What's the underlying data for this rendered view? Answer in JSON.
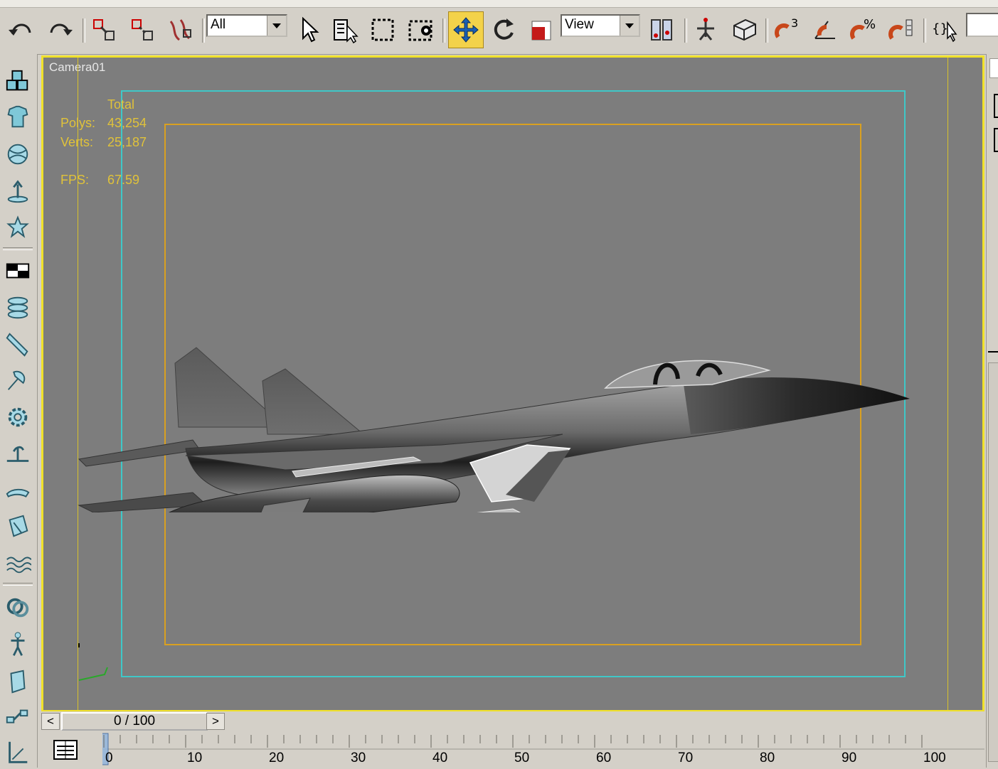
{
  "toolbar": {
    "selection_filter": "All",
    "reference_coord": "View",
    "buttons": [
      {
        "name": "undo-icon"
      },
      {
        "name": "redo-icon"
      },
      {
        "name": "select-and-link-icon"
      },
      {
        "name": "unlink-selection-icon"
      },
      {
        "name": "bind-to-space-warp-icon"
      },
      {
        "name": "select-object-icon"
      },
      {
        "name": "select-by-name-icon"
      },
      {
        "name": "rectangular-selection-region-icon"
      },
      {
        "name": "window-crossing-icon"
      },
      {
        "name": "select-and-move-icon"
      },
      {
        "name": "select-and-rotate-icon"
      },
      {
        "name": "select-and-scale-icon"
      },
      {
        "name": "use-pivot-center-icon"
      },
      {
        "name": "select-and-manipulate-icon"
      },
      {
        "name": "keyboard-shortcut-override-icon"
      },
      {
        "name": "snaps-toggle-icon"
      },
      {
        "name": "angle-snap-icon"
      },
      {
        "name": "percent-snap-icon"
      },
      {
        "name": "spinner-snap-icon"
      },
      {
        "name": "edit-named-selection-icon"
      }
    ],
    "snaps_label": "3"
  },
  "left_tools": [
    "create-objects-icon",
    "shapes-icon",
    "lights-icon",
    "cameras-icon",
    "helpers-icon",
    "compounds-icon",
    "particles-icon",
    "patch-grids-icon",
    "nurbs-icon",
    "dynamics-icon",
    "shapes-modeling-icon",
    "lights-icon-2",
    "space-warp-icon",
    "surface-icon",
    "waves-icon",
    "systems-icon",
    "biped-icon",
    "reactor-icon",
    "bones-icon",
    "ik-icon"
  ],
  "viewport": {
    "label": "Camera01",
    "stats": {
      "header": "Total",
      "polys_label": "Polys:",
      "polys_value": "43,254",
      "verts_label": "Verts:",
      "verts_value": "25,187",
      "fps_label": "FPS:",
      "fps_value": "67.59"
    },
    "colors": {
      "active_border": "#f0e12a",
      "safe_frame_outer": "#d8c22c",
      "safe_frame_action": "#3fc8c8",
      "safe_frame_title": "#d9a020",
      "background": "#7d7d7d"
    }
  },
  "time_slider": {
    "prev": "<",
    "next": ">",
    "frame_display": "0 / 100",
    "current_frame": 0,
    "total_frames": 100
  },
  "trackbar": {
    "ticks": [
      "0",
      "10",
      "20",
      "30",
      "40",
      "50",
      "60",
      "70",
      "80",
      "90",
      "100"
    ]
  }
}
